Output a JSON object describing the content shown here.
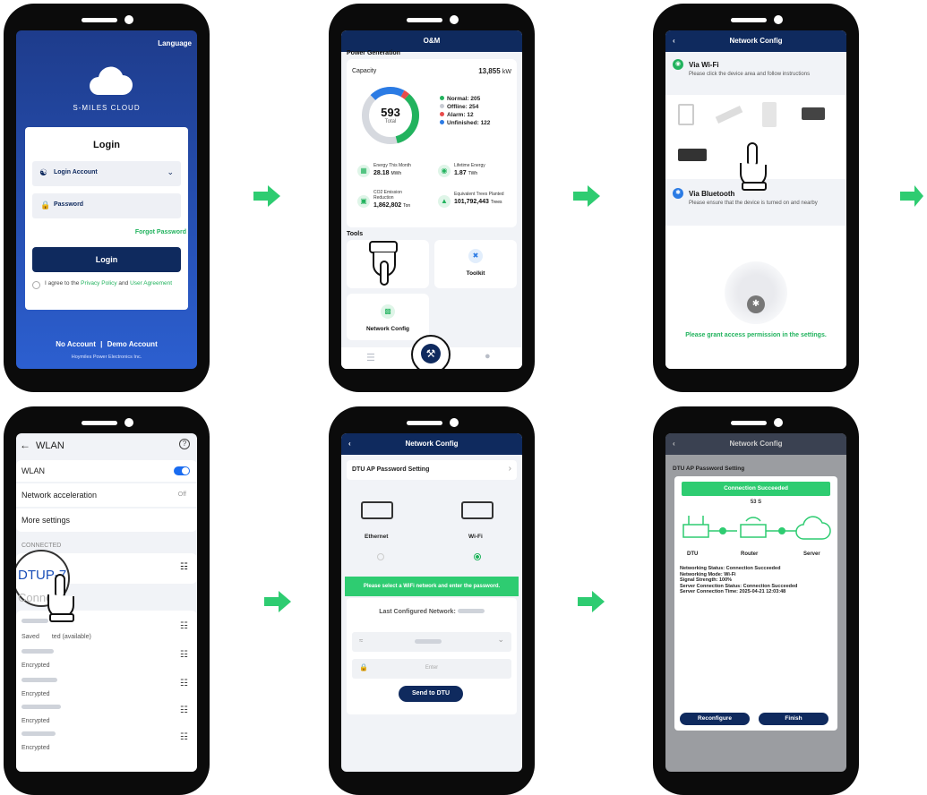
{
  "arrows": 4,
  "screen1": {
    "language": "Language",
    "brand": "S-MILES CLOUD",
    "login_title": "Login",
    "account_placeholder": "Login Account",
    "password_placeholder": "Password",
    "forgot": "Forgot Password",
    "login_btn": "Login",
    "agree_prefix": "I agree to the ",
    "privacy": "Privacy Policy",
    "and": " and ",
    "user_agreement": "User Agreement",
    "no_account": "No Account",
    "sep": "|",
    "demo": "Demo Account",
    "company": "Hoymiles Power Electronics Inc."
  },
  "screen2": {
    "header": "O&M",
    "section": "Power Generation",
    "capacity_label": "Capacity",
    "capacity_value": "13,855",
    "capacity_unit": "kW",
    "total_value": "593",
    "total_label": "Total",
    "legend": [
      {
        "label": "Normal:",
        "value": "205",
        "color": "#22b35e"
      },
      {
        "label": "Offline:",
        "value": "254",
        "color": "#c7cbd3"
      },
      {
        "label": "Alarm:",
        "value": "12",
        "color": "#e84b4b"
      },
      {
        "label": "Unfinished:",
        "value": "122",
        "color": "#2b7be4"
      }
    ],
    "stats": [
      {
        "label": "Energy This Month",
        "value": "28.18",
        "unit": "MWh"
      },
      {
        "label": "Lifetime Energy",
        "value": "1.87",
        "unit": "TWh"
      },
      {
        "label": "CO2 Emission Reduction",
        "value": "1,862,802",
        "unit": "Ton"
      },
      {
        "label": "Equivalent Trees Planted",
        "value": "101,792,443",
        "unit": "Trees"
      }
    ],
    "tools_label": "Tools",
    "toolkit": "Toolkit",
    "network_config": "Network Config"
  },
  "screen3": {
    "header": "Network Config",
    "wifi_title": "Via Wi-Fi",
    "wifi_desc": "Please click the device area and follow instructions",
    "bt_title": "Via Bluetooth",
    "bt_desc": "Please ensure that the device is turned on and nearby",
    "grant": "Please grant access permission in the settings."
  },
  "screen4": {
    "title": "WLAN",
    "wlan": "WLAN",
    "accel": "Network acceleration",
    "accel_value": "Off",
    "more": "More settings",
    "connected": "CONNECTED",
    "dtu": "DTUP-7",
    "other": "Connect",
    "saved": "Saved",
    "saved_rest": "ted (available)",
    "encrypted": "Encrypted"
  },
  "screen5": {
    "header": "Network Config",
    "ap_setting": "DTU AP Password Setting",
    "ethernet": "Ethernet",
    "wifi": "Wi-Fi",
    "banner": "Please select a WiFi network and enter the password.",
    "last_network": "Last Configured Network:",
    "enter": "Enter",
    "send": "Send to DTU"
  },
  "screen6": {
    "header": "Network Config",
    "ap_setting": "DTU AP Password Setting",
    "success": "Connection Succeeded",
    "timer": "53 S",
    "dtu": "DTU",
    "router": "Router",
    "server": "Server",
    "details": [
      "Networking Status: Connection Succeeded",
      "Networking Mode: Wi-Fi",
      "Signal Strength: 100%",
      "Server Connection Status: Connection Succeeded",
      "Server Connection Time: 2025-04-21 12:03:48"
    ],
    "reconfigure": "Reconfigure",
    "finish": "Finish"
  }
}
